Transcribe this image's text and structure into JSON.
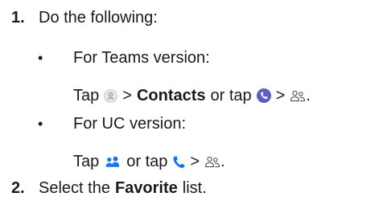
{
  "steps": [
    {
      "number": "1.",
      "text": "Do the following:",
      "options": [
        {
          "bullet": "•",
          "label": "For Teams version:",
          "tap": "Tap",
          "gt": ">",
          "target": "Contacts",
          "or_tap": "or tap",
          "end": "."
        },
        {
          "bullet": "•",
          "label": "For UC version:",
          "tap": "Tap",
          "gt": ">",
          "or_tap": "or tap",
          "end": "."
        }
      ]
    },
    {
      "number": "2.",
      "before": "Select the",
      "target": "Favorite",
      "after": "list."
    }
  ],
  "icons": {
    "teams_profile": "person-circle-icon",
    "teams_phone": "phone-circle-icon",
    "contacts": "contacts-icon",
    "uc_people": "people-icon",
    "uc_phone": "phone-icon"
  },
  "colors": {
    "text": "#1a1a1a",
    "accent_purple": "#5b5fc7",
    "accent_blue": "#1a73e8",
    "icon_gray": "#bfbfbf"
  }
}
